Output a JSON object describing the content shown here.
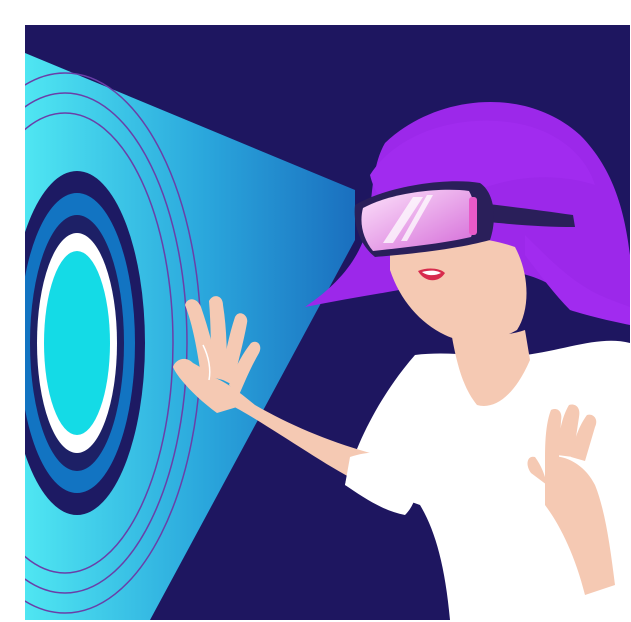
{
  "image": {
    "subject": "vr-headset-user-reaching-toward-portal",
    "colors": {
      "background": "#1e1660",
      "portal_outer": "#0f7fc5",
      "portal_ring_dark": "#1d2066",
      "portal_inner": "#14dbe6",
      "hair": "#a12bef",
      "skin": "#f5c9b3",
      "shirt": "#ffffff",
      "headset": "#2a1f5a",
      "visor": "#f5b6ef",
      "beam_near": "#35d5ef",
      "beam_far": "#1b78c4"
    }
  }
}
